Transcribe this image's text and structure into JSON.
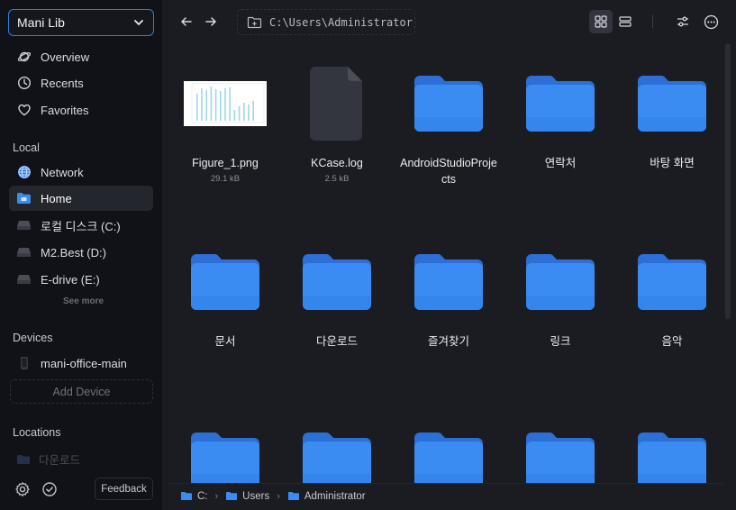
{
  "sidebar": {
    "library": "Mani Lib",
    "nav": [
      {
        "label": "Overview",
        "icon": "planet-icon"
      },
      {
        "label": "Recents",
        "icon": "clock-icon"
      },
      {
        "label": "Favorites",
        "icon": "heart-icon"
      }
    ],
    "local_title": "Local",
    "local": [
      {
        "label": "Network",
        "icon": "globe-icon"
      },
      {
        "label": "Home",
        "icon": "home-folder-icon",
        "active": true
      },
      {
        "label": "로컬 디스크 (C:)",
        "icon": "drive-icon"
      },
      {
        "label": "M2.Best (D:)",
        "icon": "drive-icon"
      },
      {
        "label": "E-drive (E:)",
        "icon": "drive-icon"
      }
    ],
    "see_more": "See more",
    "devices_title": "Devices",
    "device": "mani-office-main",
    "add_device": "Add Device",
    "locations_title": "Locations",
    "location_item": "다운로드",
    "feedback": "Feedback"
  },
  "toolbar": {
    "path": "C:\\Users\\Administrator"
  },
  "files": [
    {
      "name": "Figure_1.png",
      "size": "29.1 kB",
      "kind": "image"
    },
    {
      "name": "KCase.log",
      "size": "2.5 kB",
      "kind": "file"
    },
    {
      "name": "AndroidStudioProjects",
      "kind": "folder"
    },
    {
      "name": "연락처",
      "kind": "folder"
    },
    {
      "name": "바탕 화면",
      "kind": "folder"
    },
    {
      "name": "문서",
      "kind": "folder"
    },
    {
      "name": "다운로드",
      "kind": "folder"
    },
    {
      "name": "즐겨찾기",
      "kind": "folder"
    },
    {
      "name": "링크",
      "kind": "folder"
    },
    {
      "name": "음악",
      "kind": "folder"
    },
    {
      "name": "",
      "kind": "folder"
    },
    {
      "name": "",
      "kind": "folder"
    },
    {
      "name": "",
      "kind": "folder"
    },
    {
      "name": "",
      "kind": "folder"
    },
    {
      "name": "",
      "kind": "folder"
    }
  ],
  "breadcrumb": [
    "C:",
    "Users",
    "Administrator"
  ],
  "colors": {
    "accent": "#2f7ae5",
    "folder": "#3b8cf2"
  }
}
